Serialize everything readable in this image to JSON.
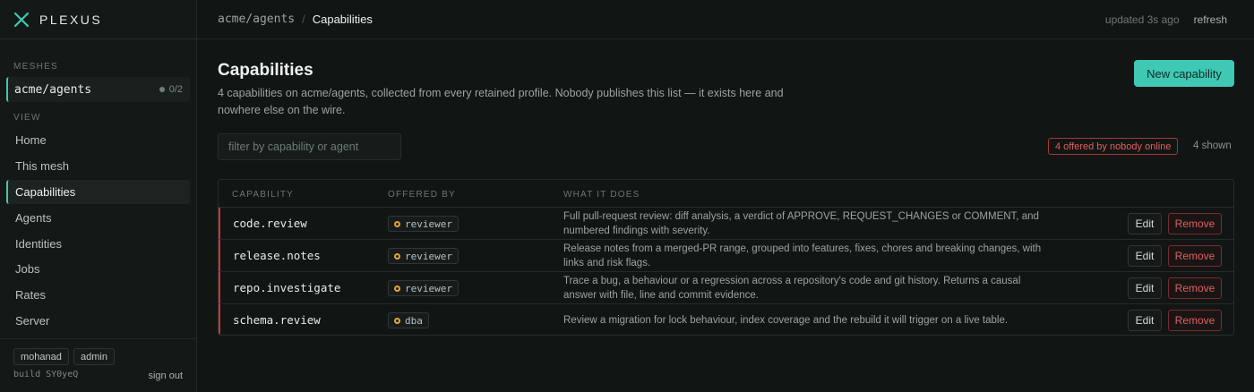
{
  "brand": {
    "name": "PLEXUS",
    "logo_icon": "x-mark-icon",
    "accent": "#3fc9b4"
  },
  "sidebar": {
    "meshes_label": "MESHES",
    "mesh": {
      "name": "acme/agents",
      "count": "0/2"
    },
    "view_label": "VIEW",
    "nav": [
      {
        "label": "Home",
        "active": false
      },
      {
        "label": "This mesh",
        "active": false
      },
      {
        "label": "Capabilities",
        "active": true
      },
      {
        "label": "Agents",
        "active": false
      },
      {
        "label": "Identities",
        "active": false
      },
      {
        "label": "Jobs",
        "active": false
      },
      {
        "label": "Rates",
        "active": false
      },
      {
        "label": "Server",
        "active": false
      }
    ],
    "user": "mohanad",
    "role": "admin",
    "build": "build SY0yeQ",
    "sign_out": "sign out"
  },
  "topbar": {
    "breadcrumb_parent": "acme/agents",
    "breadcrumb_separator": "/",
    "breadcrumb_current": "Capabilities",
    "updated": "updated 3s ago",
    "refresh": "refresh"
  },
  "main": {
    "title": "Capabilities",
    "description": "4 capabilities on acme/agents, collected from every retained profile. Nobody publishes this list — it exists here and nowhere else on the wire.",
    "new_button": "New capability",
    "filter_placeholder": "filter by capability or agent",
    "warning_badge": "4 offered by nobody online",
    "shown_count": "4 shown"
  },
  "table": {
    "headers": {
      "capability": "CAPABILITY",
      "offered_by": "OFFERED BY",
      "what_it_does": "WHAT IT DOES"
    },
    "edit_label": "Edit",
    "remove_label": "Remove",
    "rows": [
      {
        "capability": "code.review",
        "agent": "reviewer",
        "description": "Full pull-request review: diff analysis, a verdict of APPROVE, REQUEST_CHANGES or COMMENT, and numbered findings with severity."
      },
      {
        "capability": "release.notes",
        "agent": "reviewer",
        "description": "Release notes from a merged-PR range, grouped into features, fixes, chores and breaking changes, with links and risk flags."
      },
      {
        "capability": "repo.investigate",
        "agent": "reviewer",
        "description": "Trace a bug, a behaviour or a regression across a repository's code and git history. Returns a causal answer with file, line and commit evidence."
      },
      {
        "capability": "schema.review",
        "agent": "dba",
        "description": "Review a migration for lock behaviour, index coverage and the rebuild it will trigger on a live table."
      }
    ]
  },
  "colors": {
    "offline_agent": "#e8a33a",
    "danger": "#e05f5f",
    "background": "#111514"
  }
}
